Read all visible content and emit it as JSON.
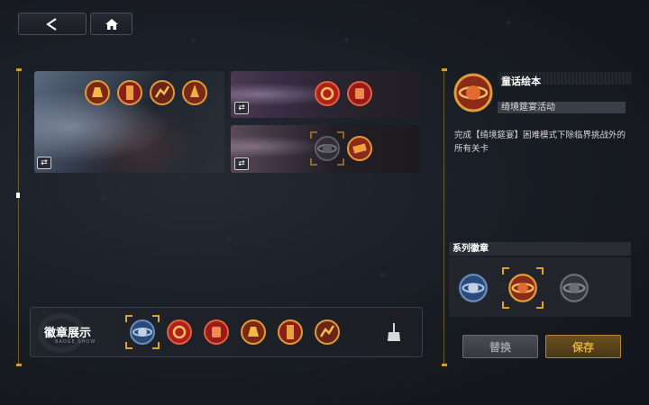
{
  "nav": {
    "back_icon": "back-arrow-icon",
    "home_icon": "home-icon"
  },
  "collections": [
    {
      "name": "collection-1",
      "badges": [
        "lion-badge",
        "scroll-badge",
        "chart-badge",
        "rocket-badge"
      ],
      "swap_icon": "swap-icon"
    },
    {
      "name": "collection-2",
      "badges": [
        "moon-badge",
        "fist-badge"
      ],
      "swap_icon": "swap-icon"
    },
    {
      "name": "collection-3",
      "badges": [
        "planet-badge",
        "sign-badge"
      ],
      "swap_icon": "swap-icon"
    }
  ],
  "badge_show": {
    "title": "徽章展示",
    "subtitle": "BADGE SHOW",
    "badges": [
      "atlas-badge",
      "moon-badge",
      "fist-badge",
      "lion-badge",
      "scroll-badge",
      "chart-badge"
    ],
    "clean_icon": "broom-icon"
  },
  "detail": {
    "title": "童话绘本",
    "event": "绮境筵宴活动",
    "description": "完成【绮境筵宴】困难模式下除临界挑战外的所有关卡",
    "series_title": "系列徽章",
    "series_badges": [
      "atlas-badge",
      "planet-badge",
      "planet-gray-badge"
    ]
  },
  "buttons": {
    "replace": "替换",
    "save": "保存"
  },
  "colors": {
    "accent": "#e0a030",
    "badge_red": "#c8342c",
    "badge_gold": "#d8882a"
  }
}
